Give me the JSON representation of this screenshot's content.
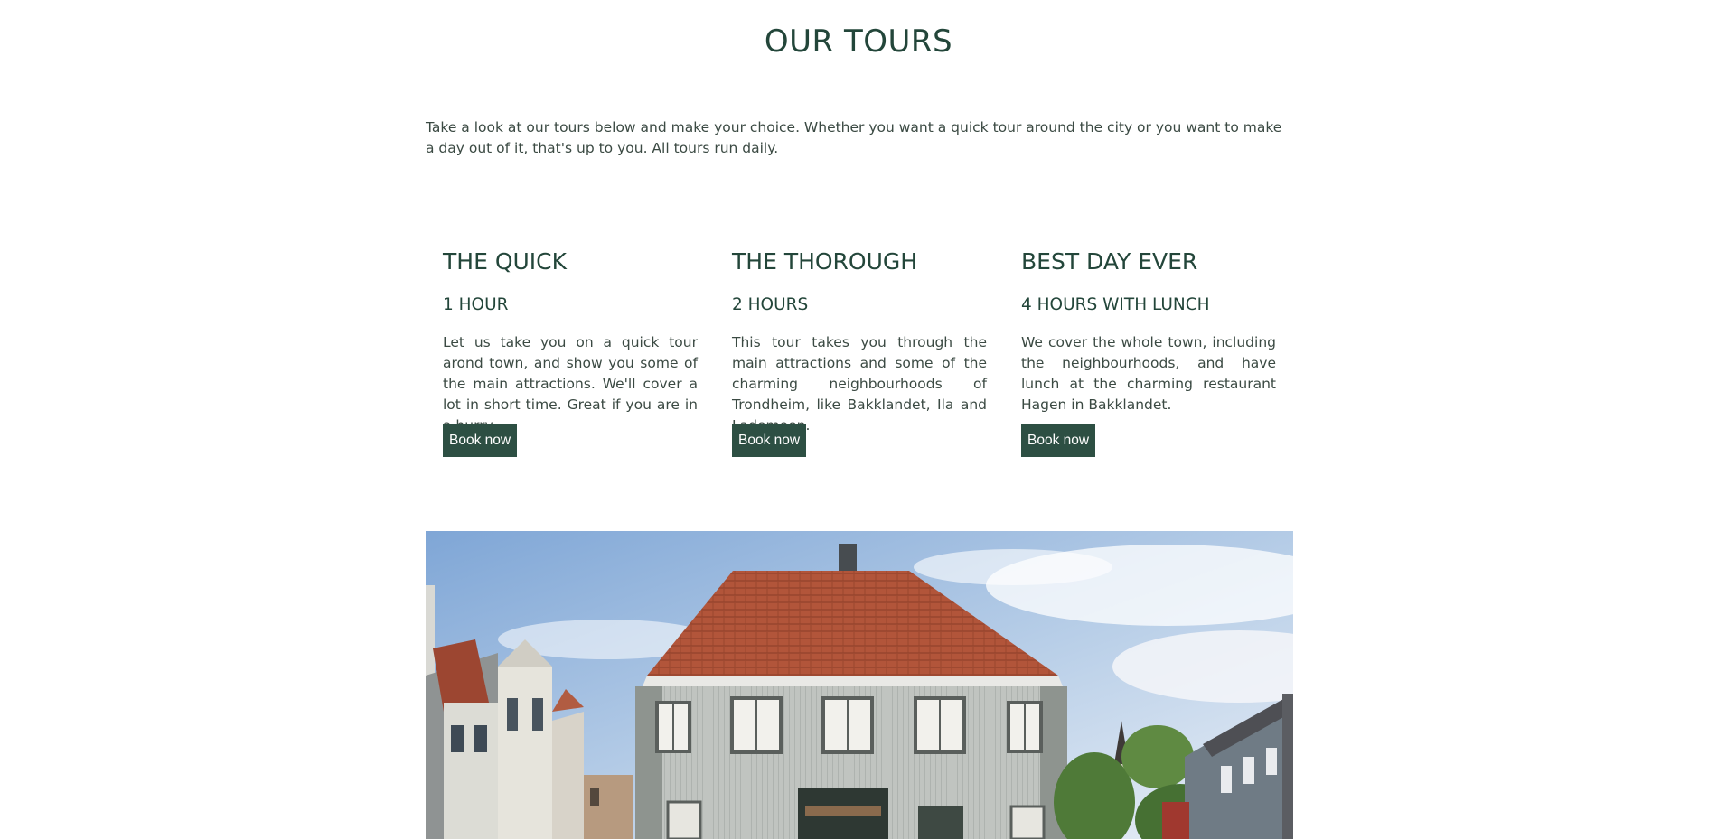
{
  "page": {
    "title": "OUR TOURS",
    "intro": "Take a look at our tours below and make your choice. Whether you want a quick tour around the city or you want to make a day out of it, that's up to you. All tours run daily."
  },
  "tours": [
    {
      "name": "THE QUICK",
      "duration": "1 HOUR",
      "description": "Let us take you on a quick tour arond town, and show you some of the main attractions. We'll cover a lot in short time. Great if you are in a hurry.",
      "button": "Book now"
    },
    {
      "name": "THE THOROUGH",
      "duration": "2 HOURS",
      "description": "This tour takes you through the main attractions and some of the charming neighbourhoods of Trondheim, like Bakklandet, Ila and Lademoen.",
      "button": "Book now"
    },
    {
      "name": "BEST DAY EVER",
      "duration": "4 HOURS WITH LUNCH",
      "description": "We cover the whole town, including the neighbourhoods, and have lunch at the charming restaurant Hagen in Bakklandet.",
      "button": "Book now"
    }
  ],
  "colors": {
    "heading": "#23463a",
    "button_bg": "#2d4f43",
    "text": "#3b4a43"
  }
}
